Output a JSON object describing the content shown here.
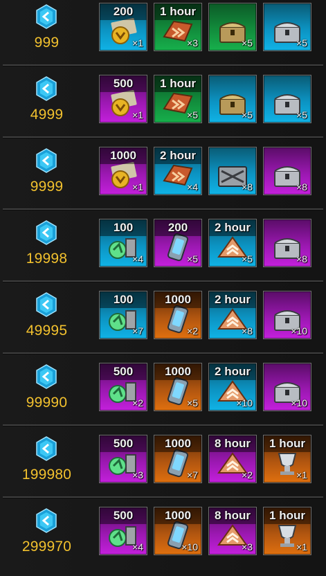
{
  "colors": {
    "blue": "#0c93c2",
    "green": "#128c3c",
    "purple": "#9a18b0",
    "orange": "#b05510",
    "threshold_text": "#f2c12e"
  },
  "rows": [
    {
      "threshold": "999",
      "gem_icon": "blue-hexagon-gem",
      "items": [
        {
          "label": "200",
          "qty": "×1",
          "color": "blue",
          "icon": "gold-coin-ticket"
        },
        {
          "label": "1 hour",
          "qty": "×3",
          "color": "green",
          "icon": "speedup-arrow"
        },
        {
          "label": "",
          "qty": "×5",
          "color": "green",
          "icon": "golden-chest"
        },
        {
          "label": "",
          "qty": "×5",
          "color": "blue",
          "icon": "silver-chest"
        }
      ]
    },
    {
      "threshold": "4999",
      "gem_icon": "blue-hexagon-gem",
      "items": [
        {
          "label": "500",
          "qty": "×1",
          "color": "purple",
          "icon": "gold-coin-ticket"
        },
        {
          "label": "1 hour",
          "qty": "×5",
          "color": "green",
          "icon": "speedup-arrow"
        },
        {
          "label": "",
          "qty": "×5",
          "color": "blue",
          "icon": "golden-chest"
        },
        {
          "label": "",
          "qty": "×5",
          "color": "blue",
          "icon": "silver-chest"
        }
      ]
    },
    {
      "threshold": "9999",
      "gem_icon": "blue-hexagon-gem",
      "items": [
        {
          "label": "1000",
          "qty": "×1",
          "color": "purple",
          "icon": "gold-coin-ticket"
        },
        {
          "label": "2 hour",
          "qty": "×4",
          "color": "blue",
          "icon": "speedup-arrow"
        },
        {
          "label": "",
          "qty": "×8",
          "color": "blue",
          "icon": "steel-crate"
        },
        {
          "label": "",
          "qty": "×8",
          "color": "purple",
          "icon": "silver-chest"
        }
      ]
    },
    {
      "threshold": "19998",
      "gem_icon": "blue-hexagon-gem",
      "items": [
        {
          "label": "100",
          "qty": "×4",
          "color": "blue",
          "icon": "green-parts"
        },
        {
          "label": "200",
          "qty": "×5",
          "color": "purple",
          "icon": "energy-canister"
        },
        {
          "label": "2 hour",
          "qty": "×5",
          "color": "blue",
          "icon": "speedup-chevrons"
        },
        {
          "label": "",
          "qty": "×8",
          "color": "purple",
          "icon": "silver-chest"
        }
      ]
    },
    {
      "threshold": "49995",
      "gem_icon": "blue-hexagon-gem",
      "items": [
        {
          "label": "100",
          "qty": "×7",
          "color": "blue",
          "icon": "green-parts"
        },
        {
          "label": "1000",
          "qty": "×2",
          "color": "orange",
          "icon": "energy-canister"
        },
        {
          "label": "2 hour",
          "qty": "×8",
          "color": "blue",
          "icon": "speedup-chevrons"
        },
        {
          "label": "",
          "qty": "×10",
          "color": "purple",
          "icon": "silver-chest"
        }
      ]
    },
    {
      "threshold": "99990",
      "gem_icon": "blue-hexagon-gem",
      "items": [
        {
          "label": "500",
          "qty": "×2",
          "color": "purple",
          "icon": "green-parts"
        },
        {
          "label": "1000",
          "qty": "×5",
          "color": "orange",
          "icon": "energy-canister"
        },
        {
          "label": "2 hour",
          "qty": "×10",
          "color": "blue",
          "icon": "speedup-chevrons"
        },
        {
          "label": "",
          "qty": "×10",
          "color": "purple",
          "icon": "silver-chest"
        }
      ]
    },
    {
      "threshold": "199980",
      "gem_icon": "blue-hexagon-gem",
      "items": [
        {
          "label": "500",
          "qty": "×3",
          "color": "purple",
          "icon": "green-parts"
        },
        {
          "label": "1000",
          "qty": "×7",
          "color": "orange",
          "icon": "energy-canister"
        },
        {
          "label": "8 hour",
          "qty": "×2",
          "color": "purple",
          "icon": "speedup-chevrons"
        },
        {
          "label": "1 hour",
          "qty": "×1",
          "color": "orange",
          "icon": "silver-trophy"
        }
      ]
    },
    {
      "threshold": "299970",
      "gem_icon": "blue-hexagon-gem",
      "items": [
        {
          "label": "500",
          "qty": "×4",
          "color": "purple",
          "icon": "green-parts"
        },
        {
          "label": "1000",
          "qty": "×10",
          "color": "orange",
          "icon": "energy-canister"
        },
        {
          "label": "8 hour",
          "qty": "×3",
          "color": "purple",
          "icon": "speedup-chevrons"
        },
        {
          "label": "1 hour",
          "qty": "×1",
          "color": "orange",
          "icon": "silver-trophy"
        }
      ]
    }
  ]
}
